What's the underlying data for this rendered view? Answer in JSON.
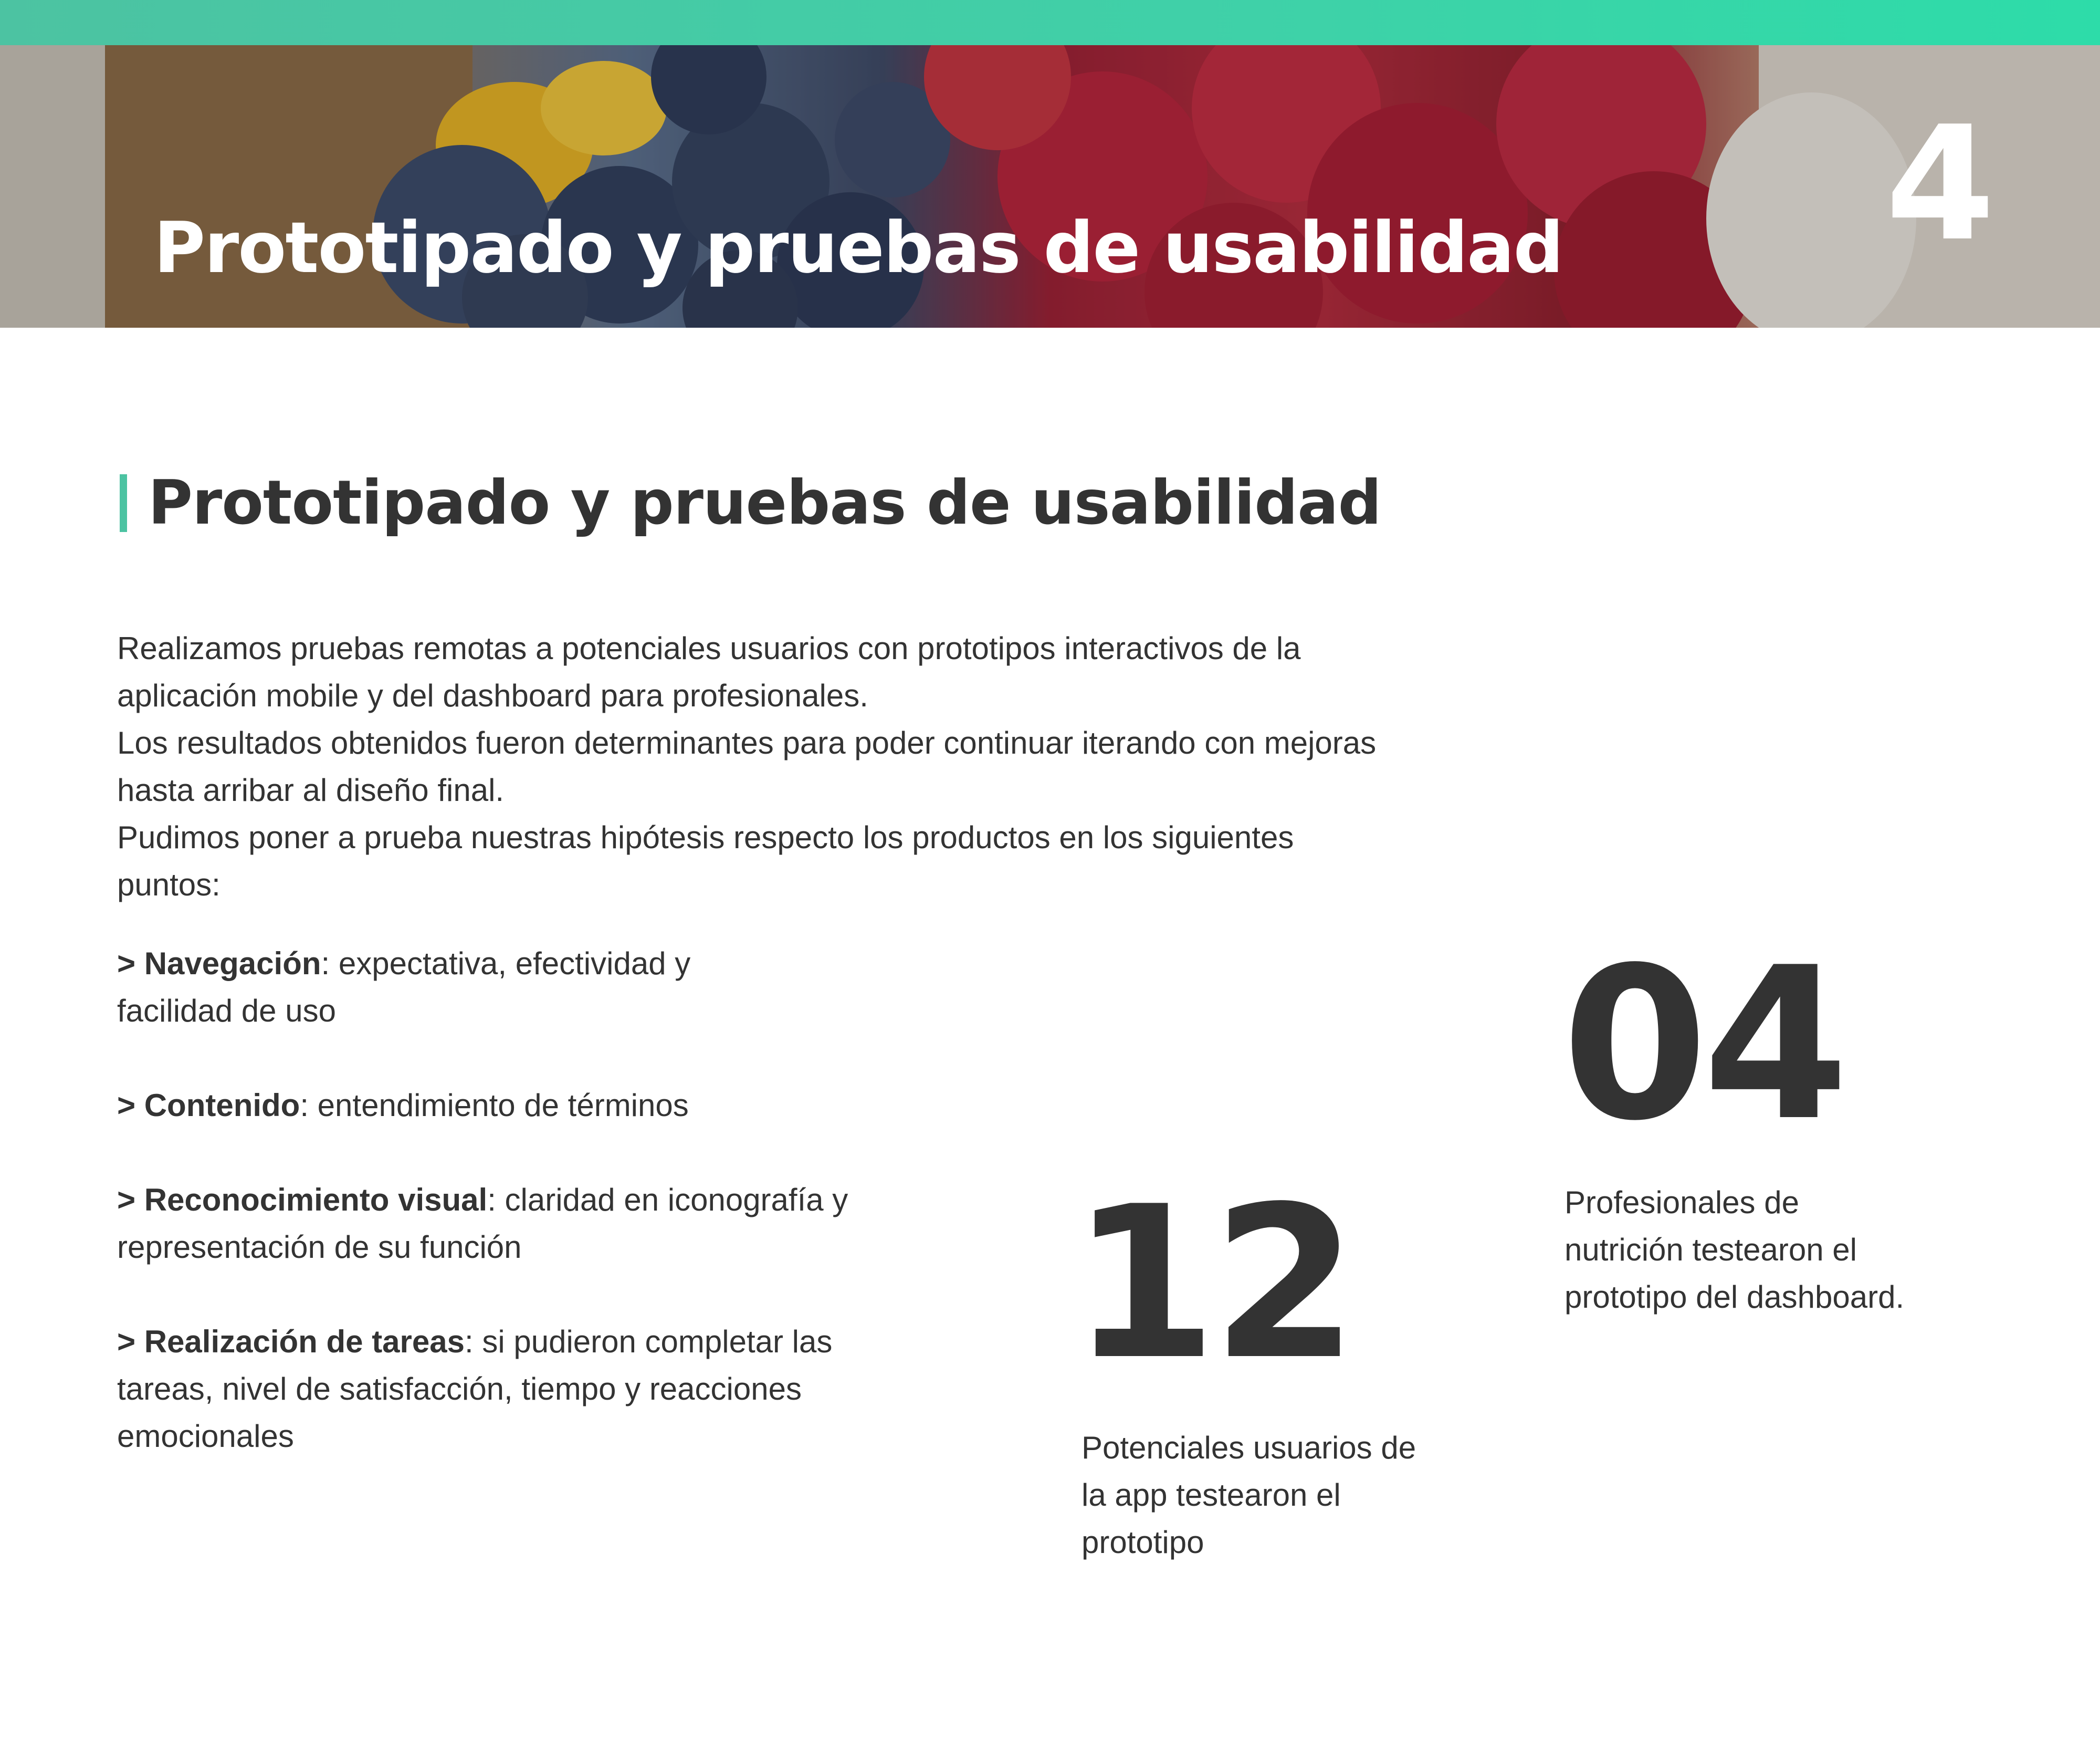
{
  "banner": {
    "title": "Prototipado y pruebas de usabilidad",
    "chapter_number": "4",
    "accent_color": "#3fd1a8"
  },
  "section": {
    "heading": "Prototipado y pruebas de usabilidad",
    "accent_color": "#4cc3a2"
  },
  "intro": {
    "paragraphs": [
      "Realizamos pruebas remotas a potenciales usuarios con prototipos interactivos de la aplicación mobile y del dashboard para profesionales.",
      "Los resultados obtenidos fueron determinantes para poder continuar iterando con mejoras hasta arribar al diseño final.",
      "Pudimos poner a prueba nuestras hipótesis respecto los productos en los siguientes puntos:"
    ]
  },
  "points": [
    {
      "marker": "> ",
      "label": "Navegación",
      "text": ": expectativa, efectividad y facilidad de uso"
    },
    {
      "marker": "> ",
      "label": "Contenido",
      "text": ": entendimiento de términos"
    },
    {
      "marker": "> ",
      "label": "Reconocimiento visual",
      "text": ": claridad en iconografía y representación de su función"
    },
    {
      "marker": "> ",
      "label": "Realización de tareas",
      "text": ": si pudieron completar las tareas, nivel de satisfacción, tiempo y reacciones emocionales"
    }
  ],
  "stats": [
    {
      "number": "12",
      "description": "Potenciales usuarios de la app testearon el prototipo"
    },
    {
      "number": "04",
      "description": "Profesionales de nutrición testearon el prototipo del dashboard."
    }
  ]
}
